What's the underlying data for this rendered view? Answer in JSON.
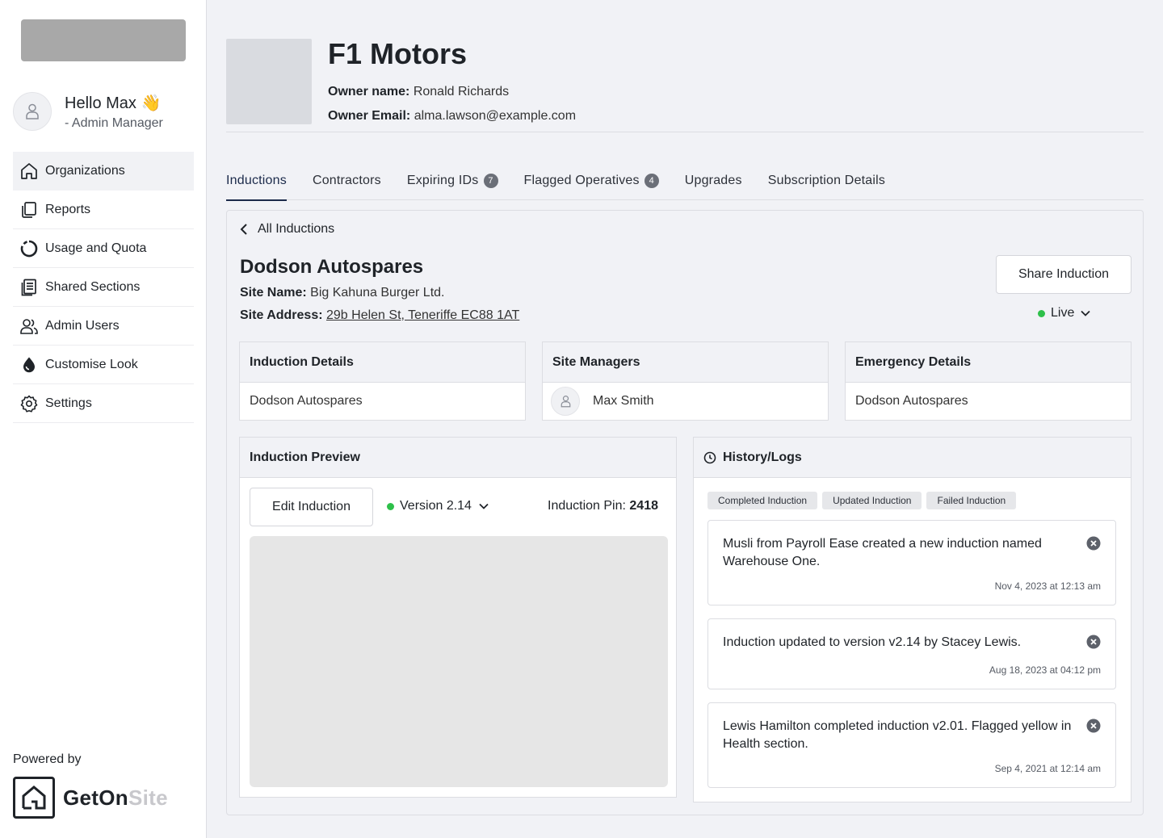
{
  "user": {
    "greeting": "Hello Max 👋",
    "role": "- Admin Manager"
  },
  "sidebar": {
    "items": [
      {
        "label": "Organizations",
        "icon": "home-icon"
      },
      {
        "label": "Reports",
        "icon": "reports-icon"
      },
      {
        "label": "Usage and Quota",
        "icon": "usage-icon"
      },
      {
        "label": "Shared Sections",
        "icon": "shared-sections-icon"
      },
      {
        "label": "Admin Users",
        "icon": "users-icon"
      },
      {
        "label": "Customise Look",
        "icon": "droplet-icon"
      },
      {
        "label": "Settings",
        "icon": "gear-icon"
      }
    ],
    "powered_by": "Powered by",
    "brand_main": "GetOn",
    "brand_accent": "Site"
  },
  "org": {
    "name": "F1 Motors",
    "owner_name_label": "Owner name:",
    "owner_name": "Ronald Richards",
    "owner_email_label": "Owner Email:",
    "owner_email": "alma.lawson@example.com"
  },
  "tabs": [
    {
      "label": "Inductions",
      "badge": null
    },
    {
      "label": "Contractors",
      "badge": null
    },
    {
      "label": "Expiring IDs",
      "badge": "7"
    },
    {
      "label": "Flagged Operatives",
      "badge": "4"
    },
    {
      "label": "Upgrades",
      "badge": null
    },
    {
      "label": "Subscription Details",
      "badge": null
    }
  ],
  "induction": {
    "back_label": "All Inductions",
    "title": "Dodson Autospares",
    "site_name_label": "Site Name:",
    "site_name": "Big Kahuna Burger Ltd.",
    "site_address_label": "Site Address:",
    "site_address": "29b Helen St, Teneriffe EC88 1AT",
    "share_label": "Share Induction",
    "status": "Live",
    "status_color": "#2ec04a"
  },
  "cards": {
    "details": {
      "title": "Induction Details",
      "value": "Dodson Autospares"
    },
    "managers": {
      "title": "Site Managers",
      "value": "Max Smith"
    },
    "emergency": {
      "title": "Emergency Details",
      "value": "Dodson Autospares"
    }
  },
  "preview": {
    "title": "Induction Preview",
    "edit_label": "Edit Induction",
    "version": "Version 2.14",
    "pin_label": "Induction Pin:",
    "pin": "2418"
  },
  "history": {
    "title": "History/Logs",
    "filters": [
      "Completed Induction",
      "Updated Induction",
      "Failed Induction"
    ],
    "logs": [
      {
        "text": "Musli from Payroll Ease created a new induction named Warehouse One.",
        "time": "Nov 4, 2023 at 12:13 am"
      },
      {
        "text": "Induction updated to version v2.14 by Stacey Lewis.",
        "time": "Aug 18, 2023 at 04:12 pm"
      },
      {
        "text": "Lewis Hamilton completed induction v2.01. Flagged yellow in Health section.",
        "time": "Sep 4, 2021 at 12:14 am"
      }
    ]
  }
}
